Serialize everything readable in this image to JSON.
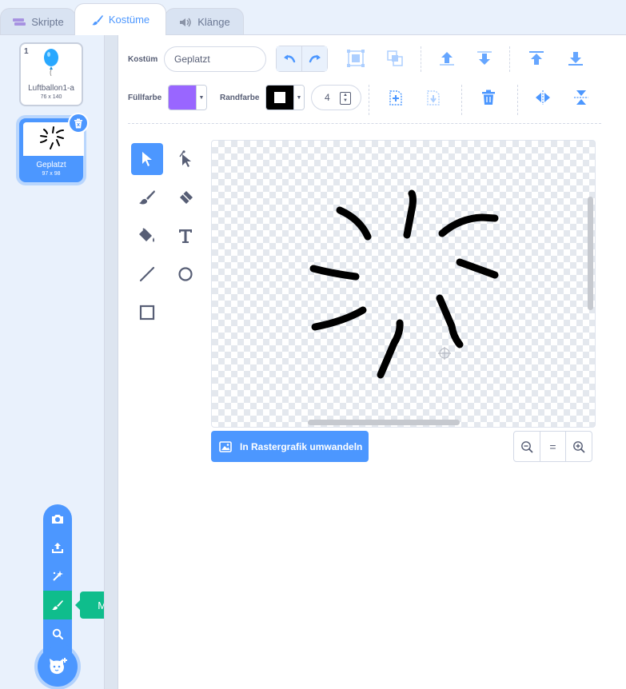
{
  "tabs": [
    {
      "label": "Skripte",
      "icon": "code-icon"
    },
    {
      "label": "Kostüme",
      "icon": "brush-icon"
    },
    {
      "label": "Klänge",
      "icon": "speaker-icon"
    }
  ],
  "costumes": [
    {
      "number": "1",
      "name": "Luftballon1-a",
      "size": "76 x 140"
    },
    {
      "number": "2",
      "name": "Geplatzt",
      "size": "97 x 98"
    }
  ],
  "toolbar": {
    "costume_label": "Kostüm",
    "costume_name": "Geplatzt",
    "fill_label": "Füllfarbe",
    "fill_color": "#9966ff",
    "outline_label": "Randfarbe",
    "outline_color": "#000000",
    "stroke_width": "4"
  },
  "canvas": {
    "convert_label": "In Rastergrafik umwandeln",
    "zoom_reset": "="
  },
  "add_menu": {
    "tooltip": "Malen",
    "items": [
      "camera-icon",
      "upload-icon",
      "surprise-icon",
      "paint-icon",
      "search-icon"
    ]
  },
  "colors": {
    "accent": "#4c97ff",
    "paint_green": "#0fbd8c"
  }
}
